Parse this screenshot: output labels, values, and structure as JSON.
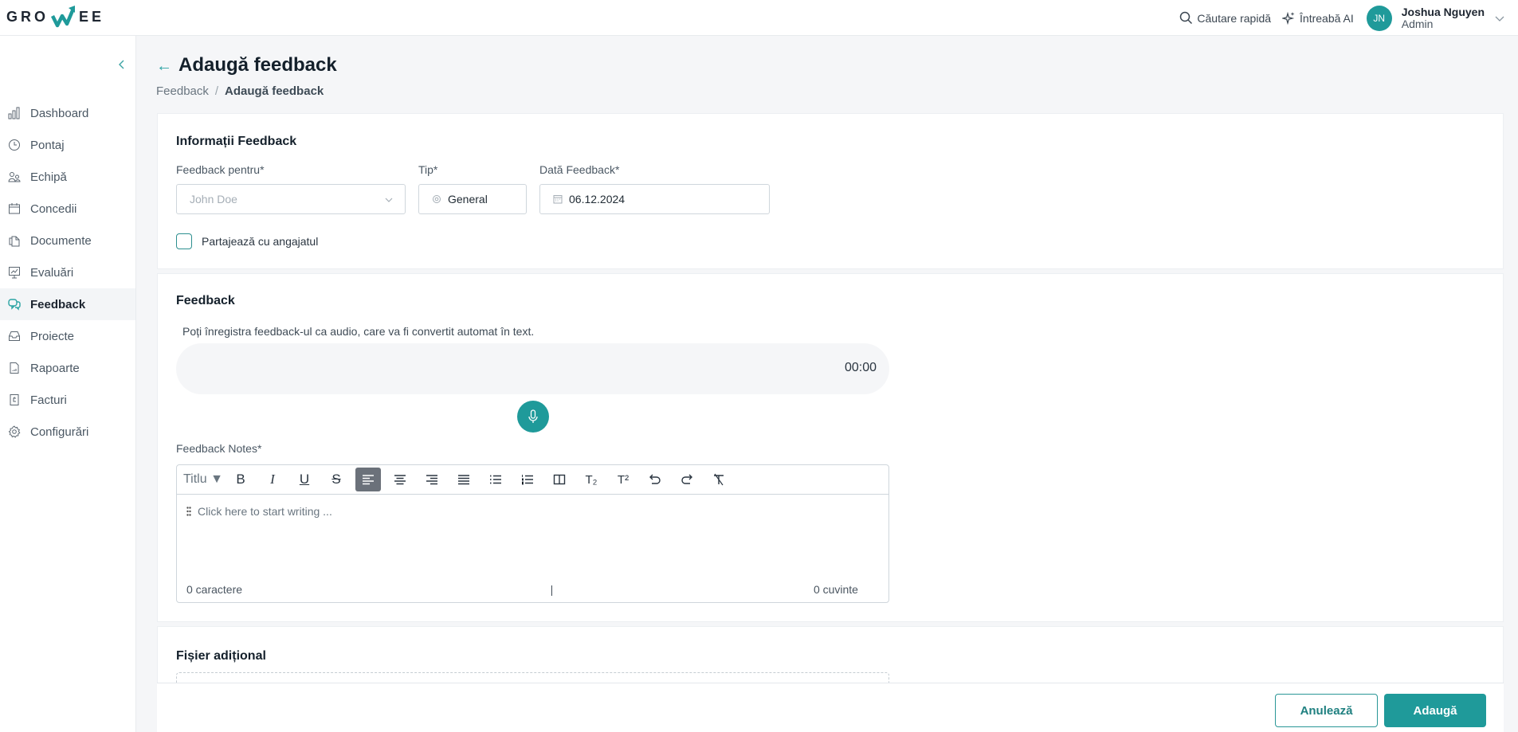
{
  "header": {
    "logo_text_left": "GRO",
    "logo_text_right": "EE",
    "quick_search": "Căutare rapidă",
    "ask_ai": "Întreabă AI",
    "user": {
      "initials": "JN",
      "name": "Joshua Nguyen",
      "role": "Admin"
    }
  },
  "sidebar": {
    "items": [
      {
        "label": "Dashboard",
        "icon": "bar-chart-icon"
      },
      {
        "label": "Pontaj",
        "icon": "clock-icon"
      },
      {
        "label": "Echipă",
        "icon": "users-icon"
      },
      {
        "label": "Concedii",
        "icon": "calendar-icon"
      },
      {
        "label": "Documente",
        "icon": "documents-icon"
      },
      {
        "label": "Evaluări",
        "icon": "presentation-chart-icon"
      },
      {
        "label": "Feedback",
        "icon": "chat-bubbles-icon",
        "active": true
      },
      {
        "label": "Proiecte",
        "icon": "inbox-icon"
      },
      {
        "label": "Rapoarte",
        "icon": "report-file-icon"
      },
      {
        "label": "Facturi",
        "icon": "invoice-icon"
      },
      {
        "label": "Configurări",
        "icon": "gear-icon"
      }
    ]
  },
  "page": {
    "title": "Adaugă feedback",
    "breadcrumb": [
      "Feedback",
      "Adaugă feedback"
    ]
  },
  "info_section": {
    "title": "Informații Feedback",
    "feedback_for": {
      "label": "Feedback pentru*",
      "placeholder": "John Doe"
    },
    "type": {
      "label": "Tip*",
      "value": "General"
    },
    "date": {
      "label": "Dată Feedback*",
      "value": "06.12.2024"
    },
    "share_checkbox": {
      "label": "Partajează cu angajatul",
      "checked": false
    }
  },
  "feedback_section": {
    "title": "Feedback",
    "hint": "Poți înregistra feedback-ul ca audio, care va fi convertit automat în text.",
    "timer": "00:00",
    "notes_label": "Feedback Notes*",
    "heading_select": "Titlu ▼",
    "toolbar": [
      {
        "name": "bold-button",
        "glyph": "B"
      },
      {
        "name": "italic-button",
        "glyph": "I"
      },
      {
        "name": "underline-button",
        "glyph": "U"
      },
      {
        "name": "strikethrough-button",
        "glyph": "S"
      },
      {
        "name": "align-left-button",
        "glyph": "≡",
        "active": true
      },
      {
        "name": "align-center-button",
        "glyph": "≡"
      },
      {
        "name": "align-right-button",
        "glyph": "≡"
      },
      {
        "name": "justify-button",
        "glyph": "≡"
      },
      {
        "name": "bullet-list-button",
        "glyph": "☰"
      },
      {
        "name": "numbered-list-button",
        "glyph": "☰"
      },
      {
        "name": "columns-button",
        "glyph": "◫"
      },
      {
        "name": "subscript-button",
        "glyph": "T₂"
      },
      {
        "name": "superscript-button",
        "glyph": "T²"
      },
      {
        "name": "undo-button",
        "glyph": "↶"
      },
      {
        "name": "redo-button",
        "glyph": "↷"
      },
      {
        "name": "clear-format-button",
        "glyph": "T̸"
      }
    ],
    "placeholder": "Click here to start writing ...",
    "char_count": "0 caractere",
    "word_count": "0 cuvinte"
  },
  "attachment_section": {
    "title": "Fișier adițional"
  },
  "footer": {
    "cancel": "Anulează",
    "add": "Adaugă"
  },
  "colors": {
    "accent": "#1f9a9a",
    "active_tool": "#6b717a"
  }
}
